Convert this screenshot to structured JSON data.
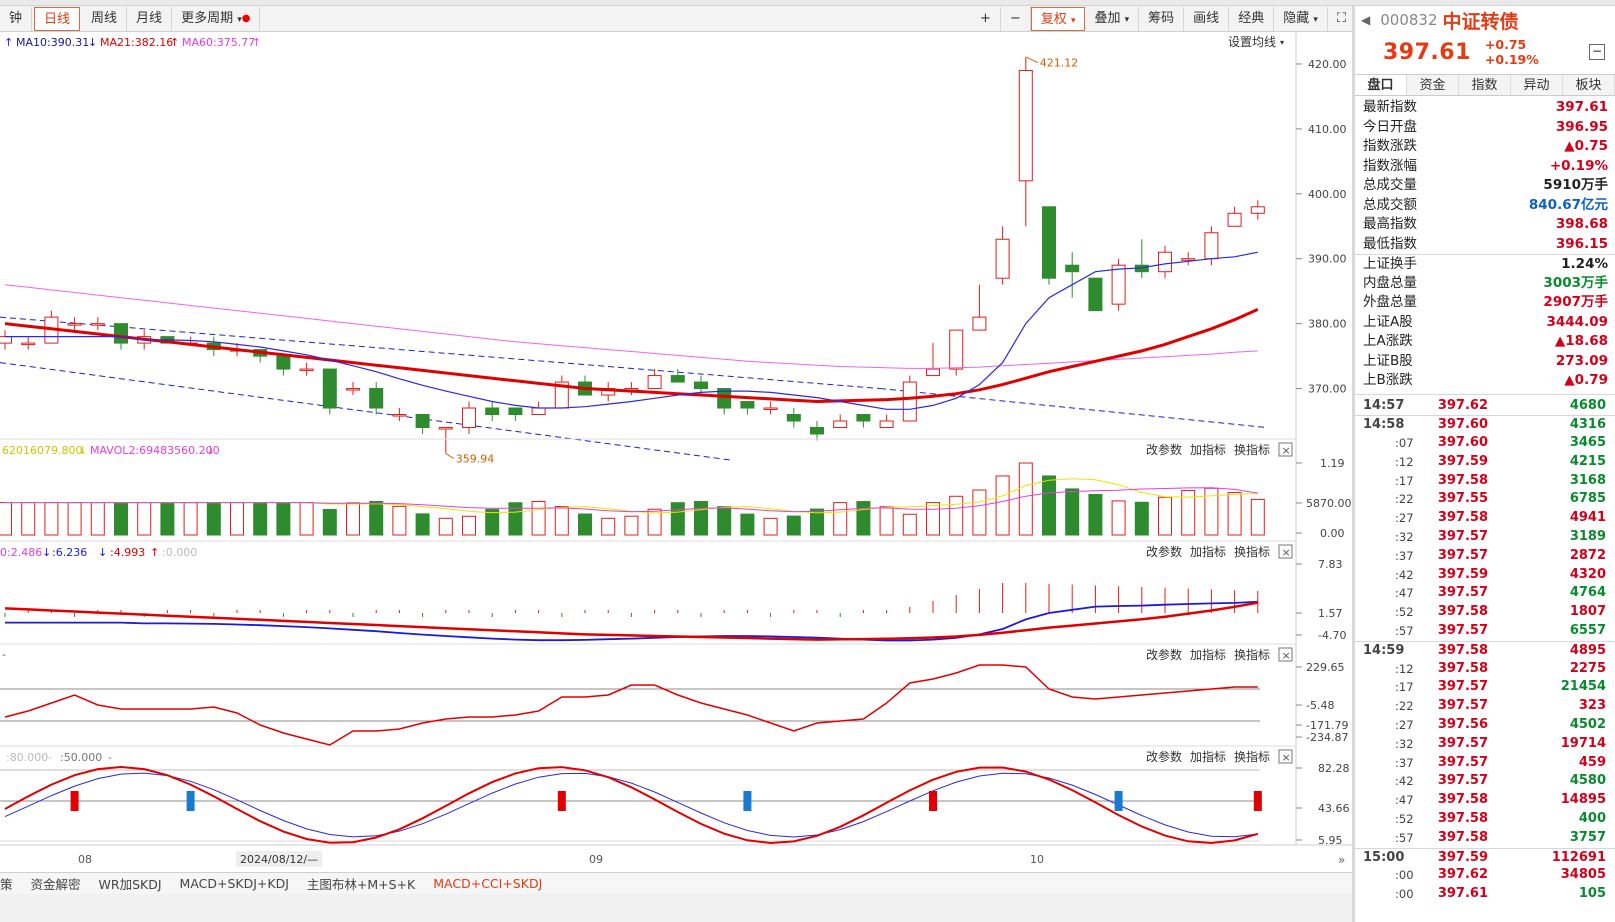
{
  "toolbar": {
    "items": [
      "钟",
      "日线",
      "周线",
      "月线",
      "更多周期"
    ],
    "right": [
      "+",
      "−",
      "复权",
      "叠加",
      "筹码",
      "画线",
      "经典",
      "隐藏"
    ]
  },
  "ma_legend": {
    "ma10": "MA10:390.31",
    "ma21": "MA21:382.16",
    "ma60": "MA60:375.77",
    "setting": "设置均线"
  },
  "price_axis": [
    "420.00",
    "410.00",
    "400.00",
    "390.00",
    "380.00",
    "370.00"
  ],
  "annot": {
    "high": "421.12",
    "low": "359.94"
  },
  "vol_legend": {
    "a": "62016079.800",
    "b": "MAVOL2:69483560.200"
  },
  "vol_axis": [
    "1.19",
    "5870.00",
    "0.00"
  ],
  "macd_legend": {
    "a": "0:2.486",
    "b": ":6.236",
    "c": ":4.993",
    "d": ":0.000"
  },
  "macd_axis": [
    "7.83",
    "1.57",
    "-4.70"
  ],
  "cci_axis": [
    "229.65",
    "-5.48",
    "-171.79",
    "-234.87"
  ],
  "kdj_legend": {
    "a": ":80.000",
    "b": ":50.000"
  },
  "kdj_axis": [
    "82.28",
    "43.66",
    "5.95"
  ],
  "panel_btns": [
    "改参数",
    "加指标",
    "换指标"
  ],
  "dates": {
    "d08": "08",
    "d09": "09",
    "d10": "10",
    "cursor": "2024/08/12/—"
  },
  "bottom_tabs": [
    "策",
    "资金解密",
    "WR加SKDJ",
    "MACD+SKDJ+KDJ",
    "主图布林+M+S+K",
    "MACD+CCI+SKDJ"
  ],
  "side": {
    "code": "000832",
    "name": "中证转债",
    "price": "397.61",
    "chg": "+0.75",
    "pct": "+0.19%",
    "tabs": [
      "盘口",
      "资金",
      "指数",
      "异动",
      "板块"
    ],
    "stats": [
      {
        "k": "最新指数",
        "v": "397.61",
        "c": "red"
      },
      {
        "k": "今日开盘",
        "v": "396.95",
        "c": "red"
      },
      {
        "k": "指数涨跌",
        "v": "▲0.75",
        "c": "red"
      },
      {
        "k": "指数涨幅",
        "v": "+0.19%",
        "c": "red"
      },
      {
        "k": "总成交量",
        "v": "5910万手",
        "c": "black"
      },
      {
        "k": "总成交额",
        "v": "840.67亿元",
        "c": "blue"
      },
      {
        "k": "最高指数",
        "v": "398.68",
        "c": "red"
      },
      {
        "k": "最低指数",
        "v": "396.15",
        "c": "red"
      },
      {
        "k": "上证换手",
        "v": "1.24%",
        "c": "black"
      },
      {
        "k": "内盘总量",
        "v": "3003万手",
        "c": "green"
      },
      {
        "k": "外盘总量",
        "v": "2907万手",
        "c": "red"
      },
      {
        "k": "上证A股",
        "v": "3444.09",
        "c": "red"
      },
      {
        "k": "上A涨跌",
        "v": "▲18.68",
        "c": "red"
      },
      {
        "k": "上证B股",
        "v": "273.09",
        "c": "red"
      },
      {
        "k": "上B涨跌",
        "v": "▲0.79",
        "c": "red"
      }
    ],
    "ticks": [
      {
        "t": "14:57",
        "p": "397.62",
        "q": "4680",
        "c": "green",
        "main": true
      },
      {
        "t": "14:58",
        "p": "397.60",
        "q": "4316",
        "c": "green",
        "main": true
      },
      {
        "t": ":07",
        "p": "397.60",
        "q": "3465",
        "c": "green"
      },
      {
        "t": ":12",
        "p": "397.59",
        "q": "4215",
        "c": "green"
      },
      {
        "t": ":17",
        "p": "397.58",
        "q": "3168",
        "c": "green"
      },
      {
        "t": ":22",
        "p": "397.55",
        "q": "6785",
        "c": "green"
      },
      {
        "t": ":27",
        "p": "397.58",
        "q": "4941",
        "c": "red"
      },
      {
        "t": ":32",
        "p": "397.57",
        "q": "3189",
        "c": "green"
      },
      {
        "t": ":37",
        "p": "397.57",
        "q": "2872",
        "c": "red"
      },
      {
        "t": ":42",
        "p": "397.59",
        "q": "4320",
        "c": "red"
      },
      {
        "t": ":47",
        "p": "397.57",
        "q": "4764",
        "c": "green"
      },
      {
        "t": ":52",
        "p": "397.58",
        "q": "1807",
        "c": "red"
      },
      {
        "t": ":57",
        "p": "397.57",
        "q": "6557",
        "c": "green"
      },
      {
        "t": "14:59",
        "p": "397.58",
        "q": "4895",
        "c": "red",
        "main": true
      },
      {
        "t": ":12",
        "p": "397.58",
        "q": "2275",
        "c": "red"
      },
      {
        "t": ":17",
        "p": "397.57",
        "q": "21454",
        "c": "green"
      },
      {
        "t": ":22",
        "p": "397.57",
        "q": "323",
        "c": "red"
      },
      {
        "t": ":27",
        "p": "397.56",
        "q": "4502",
        "c": "green"
      },
      {
        "t": ":32",
        "p": "397.57",
        "q": "19714",
        "c": "red"
      },
      {
        "t": ":37",
        "p": "397.57",
        "q": "459",
        "c": "red"
      },
      {
        "t": ":42",
        "p": "397.57",
        "q": "4580",
        "c": "green"
      },
      {
        "t": ":47",
        "p": "397.58",
        "q": "14895",
        "c": "red"
      },
      {
        "t": ":52",
        "p": "397.58",
        "q": "400",
        "c": "green"
      },
      {
        "t": ":57",
        "p": "397.58",
        "q": "3757",
        "c": "green"
      },
      {
        "t": "15:00",
        "p": "397.59",
        "q": "112691",
        "c": "red",
        "main": true
      },
      {
        "t": ":00",
        "p": "397.62",
        "q": "34805",
        "c": "red"
      },
      {
        "t": ":00",
        "p": "397.61",
        "q": "105",
        "c": "green"
      }
    ]
  },
  "chart_data": {
    "type": "candlestick",
    "price_axis": {
      "min": 365,
      "max": 422
    },
    "candles": [
      {
        "o": 377,
        "c": 378,
        "h": 379,
        "l": 376
      },
      {
        "o": 377,
        "c": 377,
        "h": 378,
        "l": 376
      },
      {
        "o": 377,
        "c": 381,
        "h": 382,
        "l": 377
      },
      {
        "o": 380,
        "c": 380,
        "h": 381,
        "l": 379
      },
      {
        "o": 380,
        "c": 380,
        "h": 381,
        "l": 379
      },
      {
        "o": 380,
        "c": 377,
        "h": 380,
        "l": 376
      },
      {
        "o": 377,
        "c": 378,
        "h": 379,
        "l": 376
      },
      {
        "o": 378,
        "c": 377,
        "h": 378,
        "l": 377
      },
      {
        "o": 377,
        "c": 377,
        "h": 378,
        "l": 377
      },
      {
        "o": 377,
        "c": 376,
        "h": 378,
        "l": 375
      },
      {
        "o": 376,
        "c": 376,
        "h": 377,
        "l": 375
      },
      {
        "o": 376,
        "c": 375,
        "h": 376,
        "l": 374
      },
      {
        "o": 375,
        "c": 373,
        "h": 375,
        "l": 372
      },
      {
        "o": 373,
        "c": 373,
        "h": 374,
        "l": 372
      },
      {
        "o": 373,
        "c": 367,
        "h": 373,
        "l": 366
      },
      {
        "o": 370,
        "c": 370,
        "h": 371,
        "l": 369
      },
      {
        "o": 370,
        "c": 367,
        "h": 371,
        "l": 366
      },
      {
        "o": 366,
        "c": 366,
        "h": 367,
        "l": 365
      },
      {
        "o": 366,
        "c": 364,
        "h": 366,
        "l": 363
      },
      {
        "o": 364,
        "c": 364,
        "h": 364,
        "l": 360
      },
      {
        "o": 364,
        "c": 367,
        "h": 368,
        "l": 363
      },
      {
        "o": 367,
        "c": 366,
        "h": 368,
        "l": 365
      },
      {
        "o": 367,
        "c": 366,
        "h": 367,
        "l": 365
      },
      {
        "o": 366,
        "c": 367,
        "h": 368,
        "l": 366
      },
      {
        "o": 367,
        "c": 371,
        "h": 372,
        "l": 367
      },
      {
        "o": 371,
        "c": 369,
        "h": 372,
        "l": 369
      },
      {
        "o": 369,
        "c": 370,
        "h": 371,
        "l": 368
      },
      {
        "o": 370,
        "c": 370,
        "h": 371,
        "l": 369
      },
      {
        "o": 370,
        "c": 372,
        "h": 373,
        "l": 370
      },
      {
        "o": 372,
        "c": 371,
        "h": 373,
        "l": 371
      },
      {
        "o": 371,
        "c": 370,
        "h": 372,
        "l": 369
      },
      {
        "o": 370,
        "c": 367,
        "h": 370,
        "l": 366
      },
      {
        "o": 368,
        "c": 367,
        "h": 368,
        "l": 366
      },
      {
        "o": 367,
        "c": 367,
        "h": 368,
        "l": 366
      },
      {
        "o": 366,
        "c": 365,
        "h": 367,
        "l": 364
      },
      {
        "o": 364,
        "c": 363,
        "h": 365,
        "l": 362
      },
      {
        "o": 364,
        "c": 365,
        "h": 366,
        "l": 364
      },
      {
        "o": 366,
        "c": 365,
        "h": 366,
        "l": 364
      },
      {
        "o": 364,
        "c": 365,
        "h": 366,
        "l": 364
      },
      {
        "o": 365,
        "c": 371,
        "h": 372,
        "l": 365
      },
      {
        "o": 372,
        "c": 373,
        "h": 377,
        "l": 372
      },
      {
        "o": 373,
        "c": 379,
        "h": 379,
        "l": 372
      },
      {
        "o": 379,
        "c": 381,
        "h": 386,
        "l": 379
      },
      {
        "o": 387,
        "c": 393,
        "h": 395,
        "l": 386
      },
      {
        "o": 402,
        "c": 419,
        "h": 421,
        "l": 395
      },
      {
        "o": 398,
        "c": 387,
        "h": 398,
        "l": 386
      },
      {
        "o": 389,
        "c": 388,
        "h": 391,
        "l": 384
      },
      {
        "o": 387,
        "c": 382,
        "h": 387,
        "l": 382
      },
      {
        "o": 383,
        "c": 389,
        "h": 390,
        "l": 382
      },
      {
        "o": 389,
        "c": 388,
        "h": 393,
        "l": 387
      },
      {
        "o": 388,
        "c": 391,
        "h": 392,
        "l": 387
      },
      {
        "o": 390,
        "c": 390,
        "h": 391,
        "l": 389
      },
      {
        "o": 390,
        "c": 394,
        "h": 395,
        "l": 389
      },
      {
        "o": 395,
        "c": 397,
        "h": 398,
        "l": 395
      },
      {
        "o": 397,
        "c": 398,
        "h": 399,
        "l": 396
      }
    ],
    "ma10": [
      378,
      378,
      378,
      378,
      378,
      378,
      377.5,
      377.5,
      377.4,
      377.2,
      376.8,
      376.4,
      375.8,
      375.2,
      374.4,
      373.5,
      372.6,
      371.5,
      370.5,
      369.6,
      368.8,
      368,
      367.4,
      367,
      367,
      367.2,
      367.6,
      368,
      368.5,
      369,
      369.4,
      369.6,
      369.6,
      369.4,
      369,
      368.6,
      368,
      367.4,
      366.8,
      366.8,
      367.4,
      368.5,
      370.6,
      374,
      380,
      384,
      386,
      388,
      388.4,
      388.6,
      389.2,
      389.6,
      390,
      390.3,
      391
    ],
    "ma21": [
      380,
      379.6,
      379.2,
      378.8,
      378.4,
      378,
      377.6,
      377.2,
      376.8,
      376.4,
      376,
      375.6,
      375.2,
      374.8,
      374.4,
      374,
      373.6,
      373.2,
      372.8,
      372.4,
      372,
      371.6,
      371.2,
      370.8,
      370.4,
      370,
      369.8,
      369.6,
      369.4,
      369.2,
      369,
      368.8,
      368.6,
      368.4,
      368.2,
      368,
      368.1,
      368.2,
      368.3,
      368.5,
      368.8,
      369.2,
      369.8,
      370.6,
      371.6,
      372.6,
      373.4,
      374.2,
      375,
      375.8,
      376.8,
      378,
      379.2,
      380.6,
      382.2
    ],
    "ma60": [
      386,
      385.6,
      385.2,
      384.8,
      384.4,
      384,
      383.6,
      383.2,
      382.8,
      382.4,
      382,
      381.6,
      381.2,
      380.8,
      380.4,
      380,
      379.6,
      379.2,
      378.8,
      378.4,
      378,
      377.6,
      377.2,
      376.9,
      376.6,
      376.3,
      376,
      375.7,
      375.4,
      375.1,
      374.8,
      374.5,
      374.2,
      374,
      373.8,
      373.6,
      373.4,
      373.3,
      373.2,
      373.1,
      373.1,
      373.2,
      373.3,
      373.5,
      373.7,
      373.9,
      374.1,
      374.3,
      374.5,
      374.7,
      374.9,
      375.1,
      375.3,
      375.6,
      375.8
    ]
  }
}
